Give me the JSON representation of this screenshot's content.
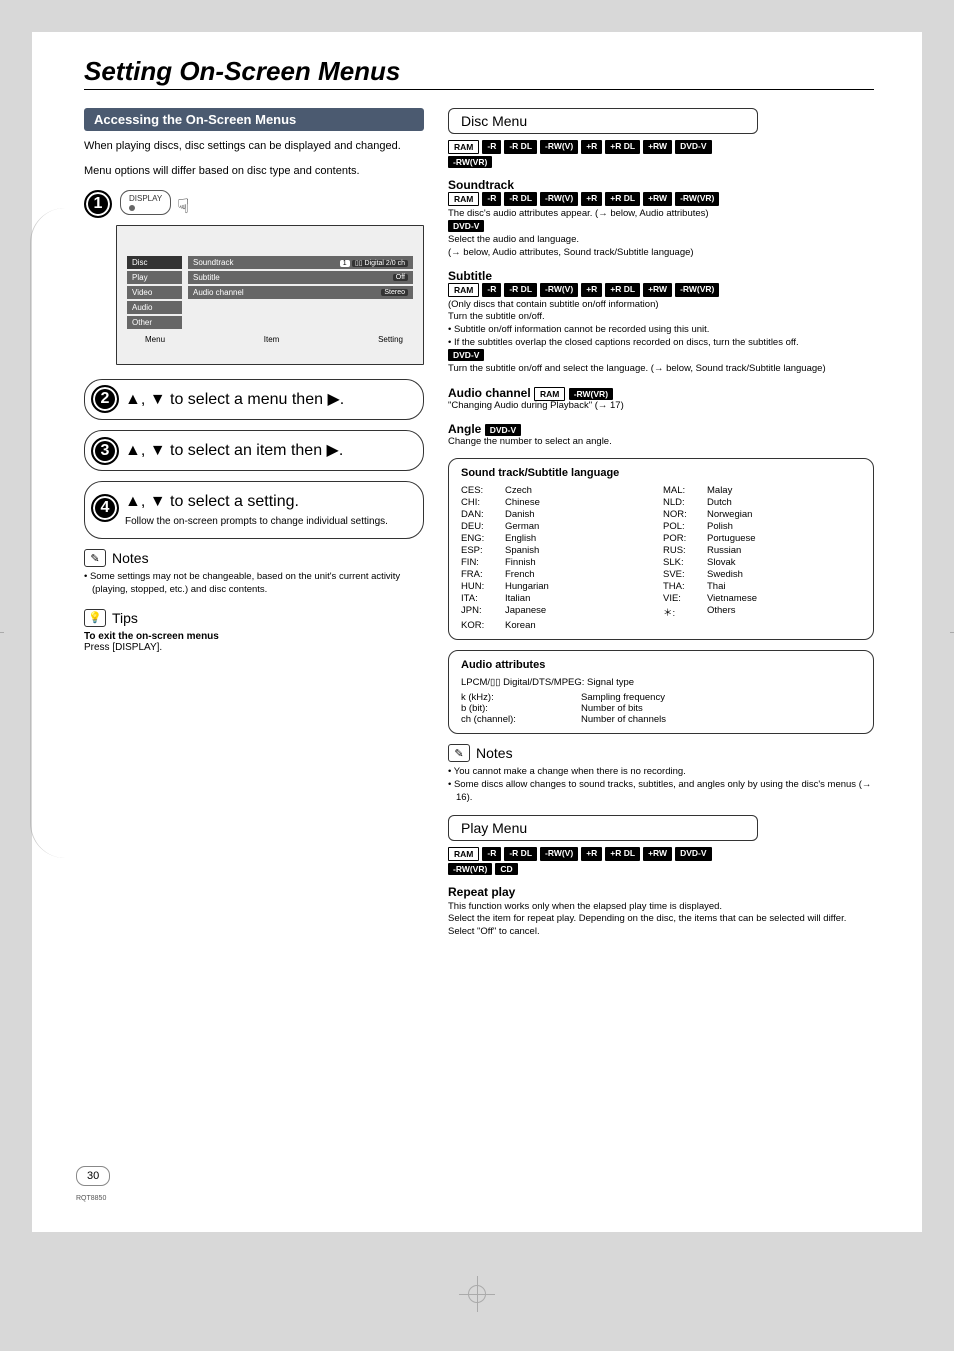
{
  "title": "Setting On-Screen Menus",
  "left": {
    "section_header": "Accessing the On-Screen Menus",
    "intro_1": "When playing discs, disc settings can be displayed and changed.",
    "intro_2": "Menu options will differ based on disc type and contents.",
    "display_btn": "DISPLAY",
    "osd": {
      "menu_items": [
        "Disc",
        "Play",
        "Video",
        "Audio",
        "Other"
      ],
      "rows": [
        {
          "label": "Soundtrack",
          "chips": [
            "1",
            "▯▯ Digital  2/0 ch"
          ]
        },
        {
          "label": "Subtitle",
          "chips": [
            "Off"
          ]
        },
        {
          "label": "Audio channel",
          "chips": [
            "Stereo"
          ]
        }
      ],
      "footer_menu": "Menu",
      "footer_item": "Item",
      "footer_setting": "Setting"
    },
    "step2": "▲, ▼ to select a menu then ▶.",
    "step3": "▲, ▼ to select an item then ▶.",
    "step4_main": "▲, ▼ to select a setting.",
    "step4_sub": "Follow the on-screen prompts to change individual settings.",
    "notes_header": "Notes",
    "notes_bullet": "Some settings may not be changeable, based on the unit's current activity (playing, stopped, etc.) and disc contents.",
    "tips_header": "Tips",
    "tips_bold": "To exit the on-screen menus",
    "tips_line": "Press [DISPLAY]."
  },
  "right": {
    "disc_menu_header": "Disc Menu",
    "disc_tags_row1": [
      "RAM",
      "-R",
      "-R DL",
      "-RW(V)",
      "+R",
      "+R DL",
      "+RW",
      "DVD-V"
    ],
    "disc_tags_row2": [
      "-RW(VR)"
    ],
    "soundtrack_h": "Soundtrack",
    "soundtrack_tags": [
      "RAM",
      "-R",
      "-R DL",
      "-RW(V)",
      "+R",
      "+R DL",
      "+RW",
      "-RW(VR)"
    ],
    "soundtrack_body1": "The disc's audio attributes appear. (→ below, Audio attributes)",
    "soundtrack_dvdv": "DVD-V",
    "soundtrack_body2": "Select the audio and language.",
    "soundtrack_body3": "(→ below, Audio attributes, Sound track/Subtitle language)",
    "subtitle_h": "Subtitle",
    "subtitle_tags": [
      "RAM",
      "-R",
      "-R DL",
      "-RW(V)",
      "+R",
      "+R DL",
      "+RW",
      "-RW(VR)"
    ],
    "subtitle_body1": "(Only discs that contain subtitle on/off information)",
    "subtitle_body2": "Turn the subtitle on/off.",
    "subtitle_bullet1": "Subtitle on/off information cannot be recorded using this unit.",
    "subtitle_bullet2": "If the subtitles overlap the closed captions recorded on discs, turn the subtitles off.",
    "subtitle_dvdv": "DVD-V",
    "subtitle_body3": "Turn the subtitle on/off and select the language. (→ below, Sound track/Subtitle language)",
    "audioch_h": "Audio channel",
    "audioch_tags": [
      "RAM",
      "-RW(VR)"
    ],
    "audioch_body": "\"Changing Audio during Playback\" (→ 17)",
    "angle_h": "Angle",
    "angle_tag": "DVD-V",
    "angle_body": "Change the number to select an angle.",
    "lang_title": "Sound track/Subtitle language",
    "lang_pairs": [
      [
        "CES:",
        "Czech",
        "MAL:",
        "Malay"
      ],
      [
        "CHI:",
        "Chinese",
        "NLD:",
        "Dutch"
      ],
      [
        "DAN:",
        "Danish",
        "NOR:",
        "Norwegian"
      ],
      [
        "DEU:",
        "German",
        "POL:",
        "Polish"
      ],
      [
        "ENG:",
        "English",
        "POR:",
        "Portuguese"
      ],
      [
        "ESP:",
        "Spanish",
        "RUS:",
        "Russian"
      ],
      [
        "FIN:",
        "Finnish",
        "SLK:",
        "Slovak"
      ],
      [
        "FRA:",
        "French",
        "SVE:",
        "Swedish"
      ],
      [
        "HUN:",
        "Hungarian",
        "THA:",
        "Thai"
      ],
      [
        "ITA:",
        "Italian",
        "VIE:",
        "Vietnamese"
      ],
      [
        "JPN:",
        "Japanese",
        "＊:",
        "Others"
      ],
      [
        "KOR:",
        "Korean",
        "",
        ""
      ]
    ],
    "attr_title": "Audio attributes",
    "attr_line": "LPCM/▯▯ Digital/DTS/MPEG: Signal type",
    "attr_rows": [
      [
        "k (kHz):",
        "Sampling frequency"
      ],
      [
        "b (bit):",
        "Number of bits"
      ],
      [
        "ch (channel):",
        "Number of channels"
      ]
    ],
    "notes_header": "Notes",
    "notes_bullet1": "You cannot make a change when there is no recording.",
    "notes_bullet2": "Some discs allow changes to sound tracks, subtitles, and angles only by using the disc's menus (→ 16).",
    "play_menu_header": "Play Menu",
    "play_tags_row1": [
      "RAM",
      "-R",
      "-R DL",
      "-RW(V)",
      "+R",
      "+R DL",
      "+RW",
      "DVD-V"
    ],
    "play_tags_row2": [
      "-RW(VR)",
      "CD"
    ],
    "repeat_h": "Repeat play",
    "repeat_body1": "This function works only when the elapsed play time is displayed.",
    "repeat_body2": "Select the item for repeat play. Depending on the disc, the items that can be selected will differ.",
    "repeat_body3": "Select \"Off\" to cancel."
  },
  "page_number": "30",
  "footer_code": "RQT8850"
}
